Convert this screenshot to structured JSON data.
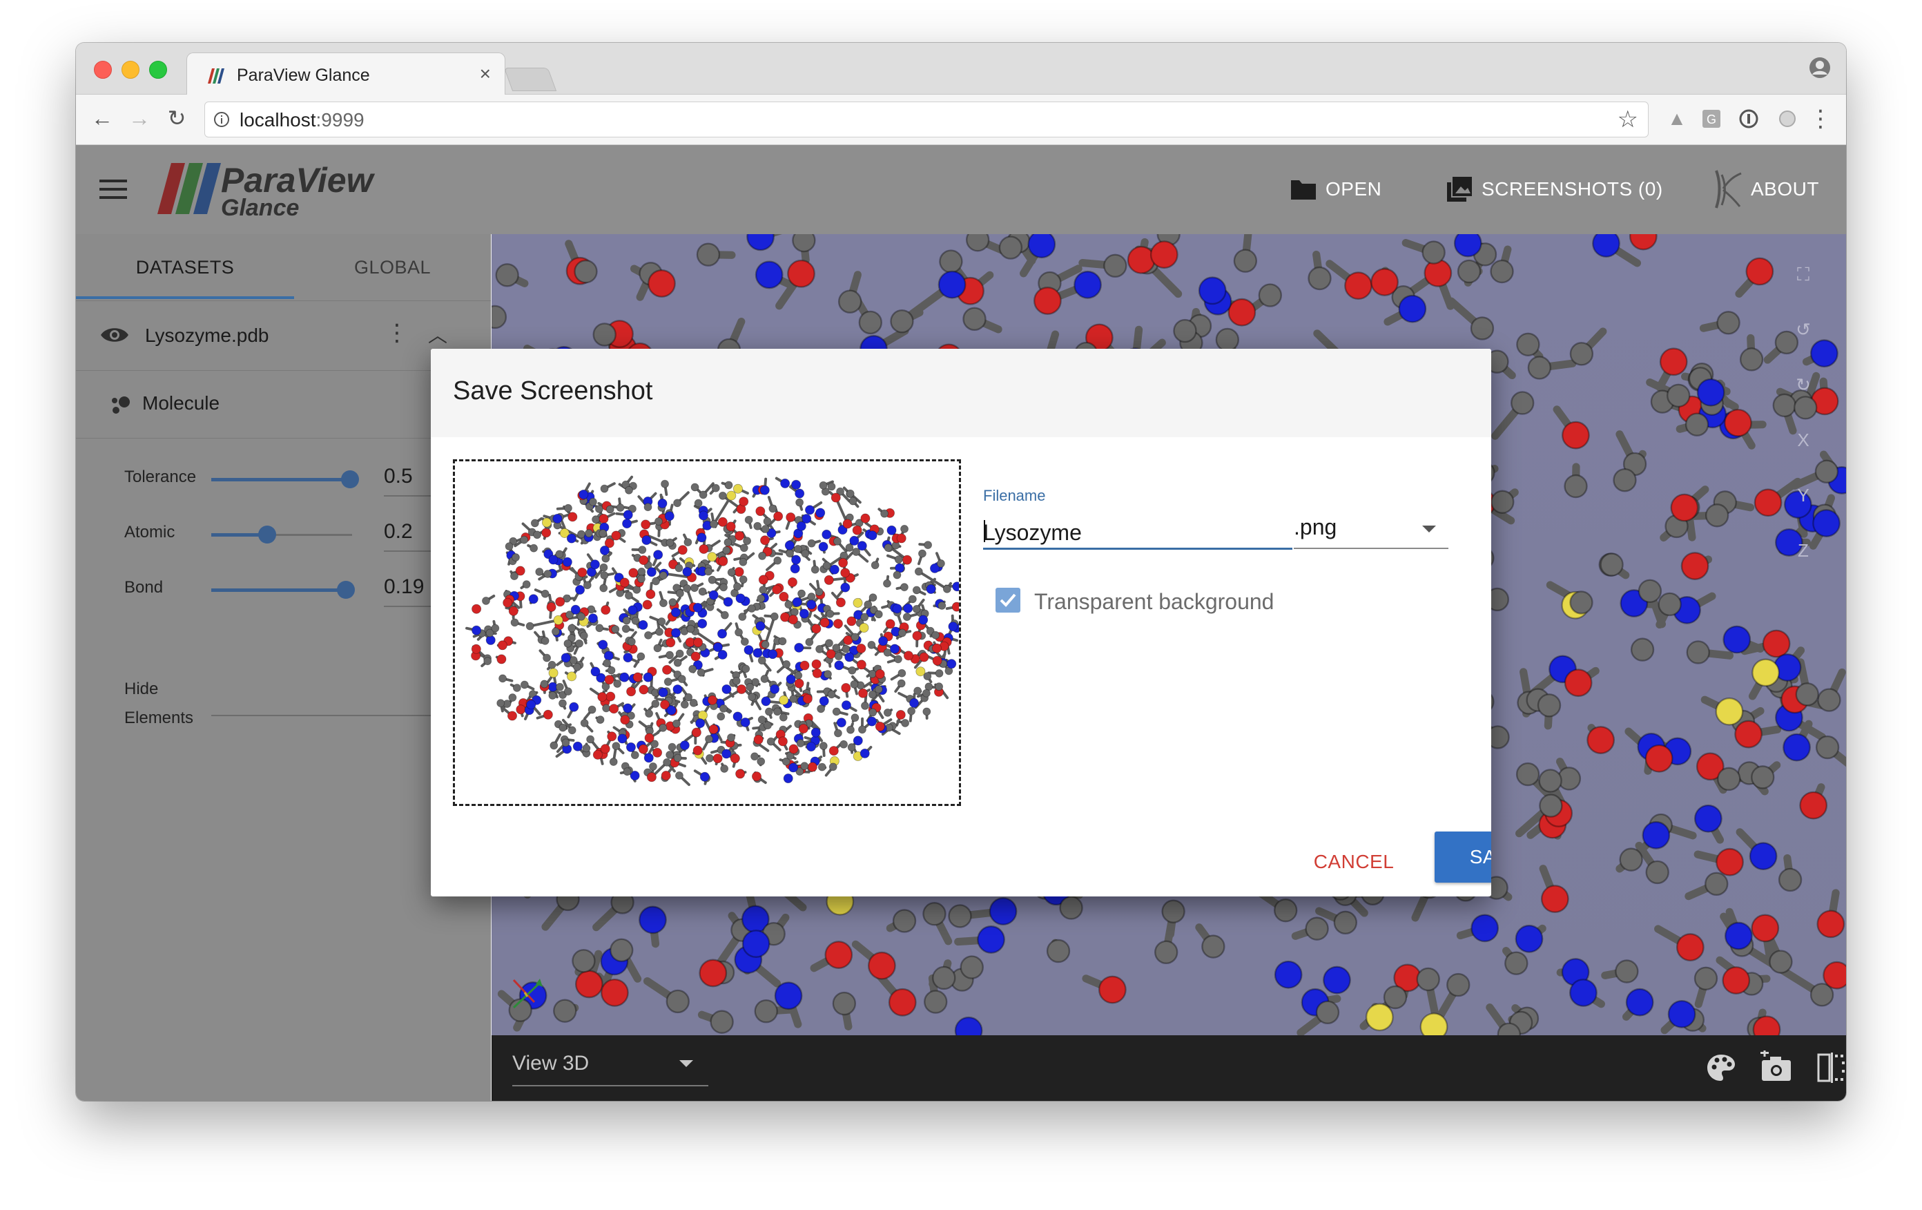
{
  "browser": {
    "tab_title": "ParaView Glance",
    "tab_close": "×",
    "url_host": "localhost",
    "url_port": ":9999"
  },
  "header": {
    "open_label": "OPEN",
    "screenshots_label": "SCREENSHOTS (0)",
    "about_label": "ABOUT",
    "logo_line1": "ParaView",
    "logo_line2": "Glance"
  },
  "panel": {
    "tabs": [
      {
        "label": "DATASETS",
        "active": true
      },
      {
        "label": "GLOBAL",
        "active": false
      }
    ],
    "dataset_name": "Lysozyme.pdb",
    "representation": "Molecule",
    "params": [
      {
        "label": "Tolerance",
        "value": "0.5",
        "fraction": 0.98
      },
      {
        "label": "Atomic",
        "value": "0.2",
        "fraction": 0.4
      },
      {
        "label": "Bond",
        "value": "0.19",
        "fraction": 0.95
      }
    ],
    "hide_label_line1": "Hide",
    "hide_label_line2": "Elements"
  },
  "view": {
    "side_tools": [
      "reset-camera",
      "rotate-left",
      "rotate-right",
      "X",
      "Y",
      "Z"
    ],
    "view_type": "View 3D"
  },
  "dialog": {
    "title": "Save Screenshot",
    "filename_label": "Filename",
    "filename_value": "Lysozyme",
    "extension": ".png",
    "transparent_label": "Transparent background",
    "transparent_checked": true,
    "cancel_label": "CANCEL",
    "save_label": "SAVE"
  },
  "colors": {
    "accent": "#3372c5",
    "cancel": "#d13e35",
    "header_bg": "#8e8e8e",
    "view_bg": "#7e7fa0",
    "atom_red": "#d42424",
    "atom_blue": "#1822d8",
    "atom_grey": "#6a6a6a",
    "atom_yellow": "#e6d84a"
  }
}
